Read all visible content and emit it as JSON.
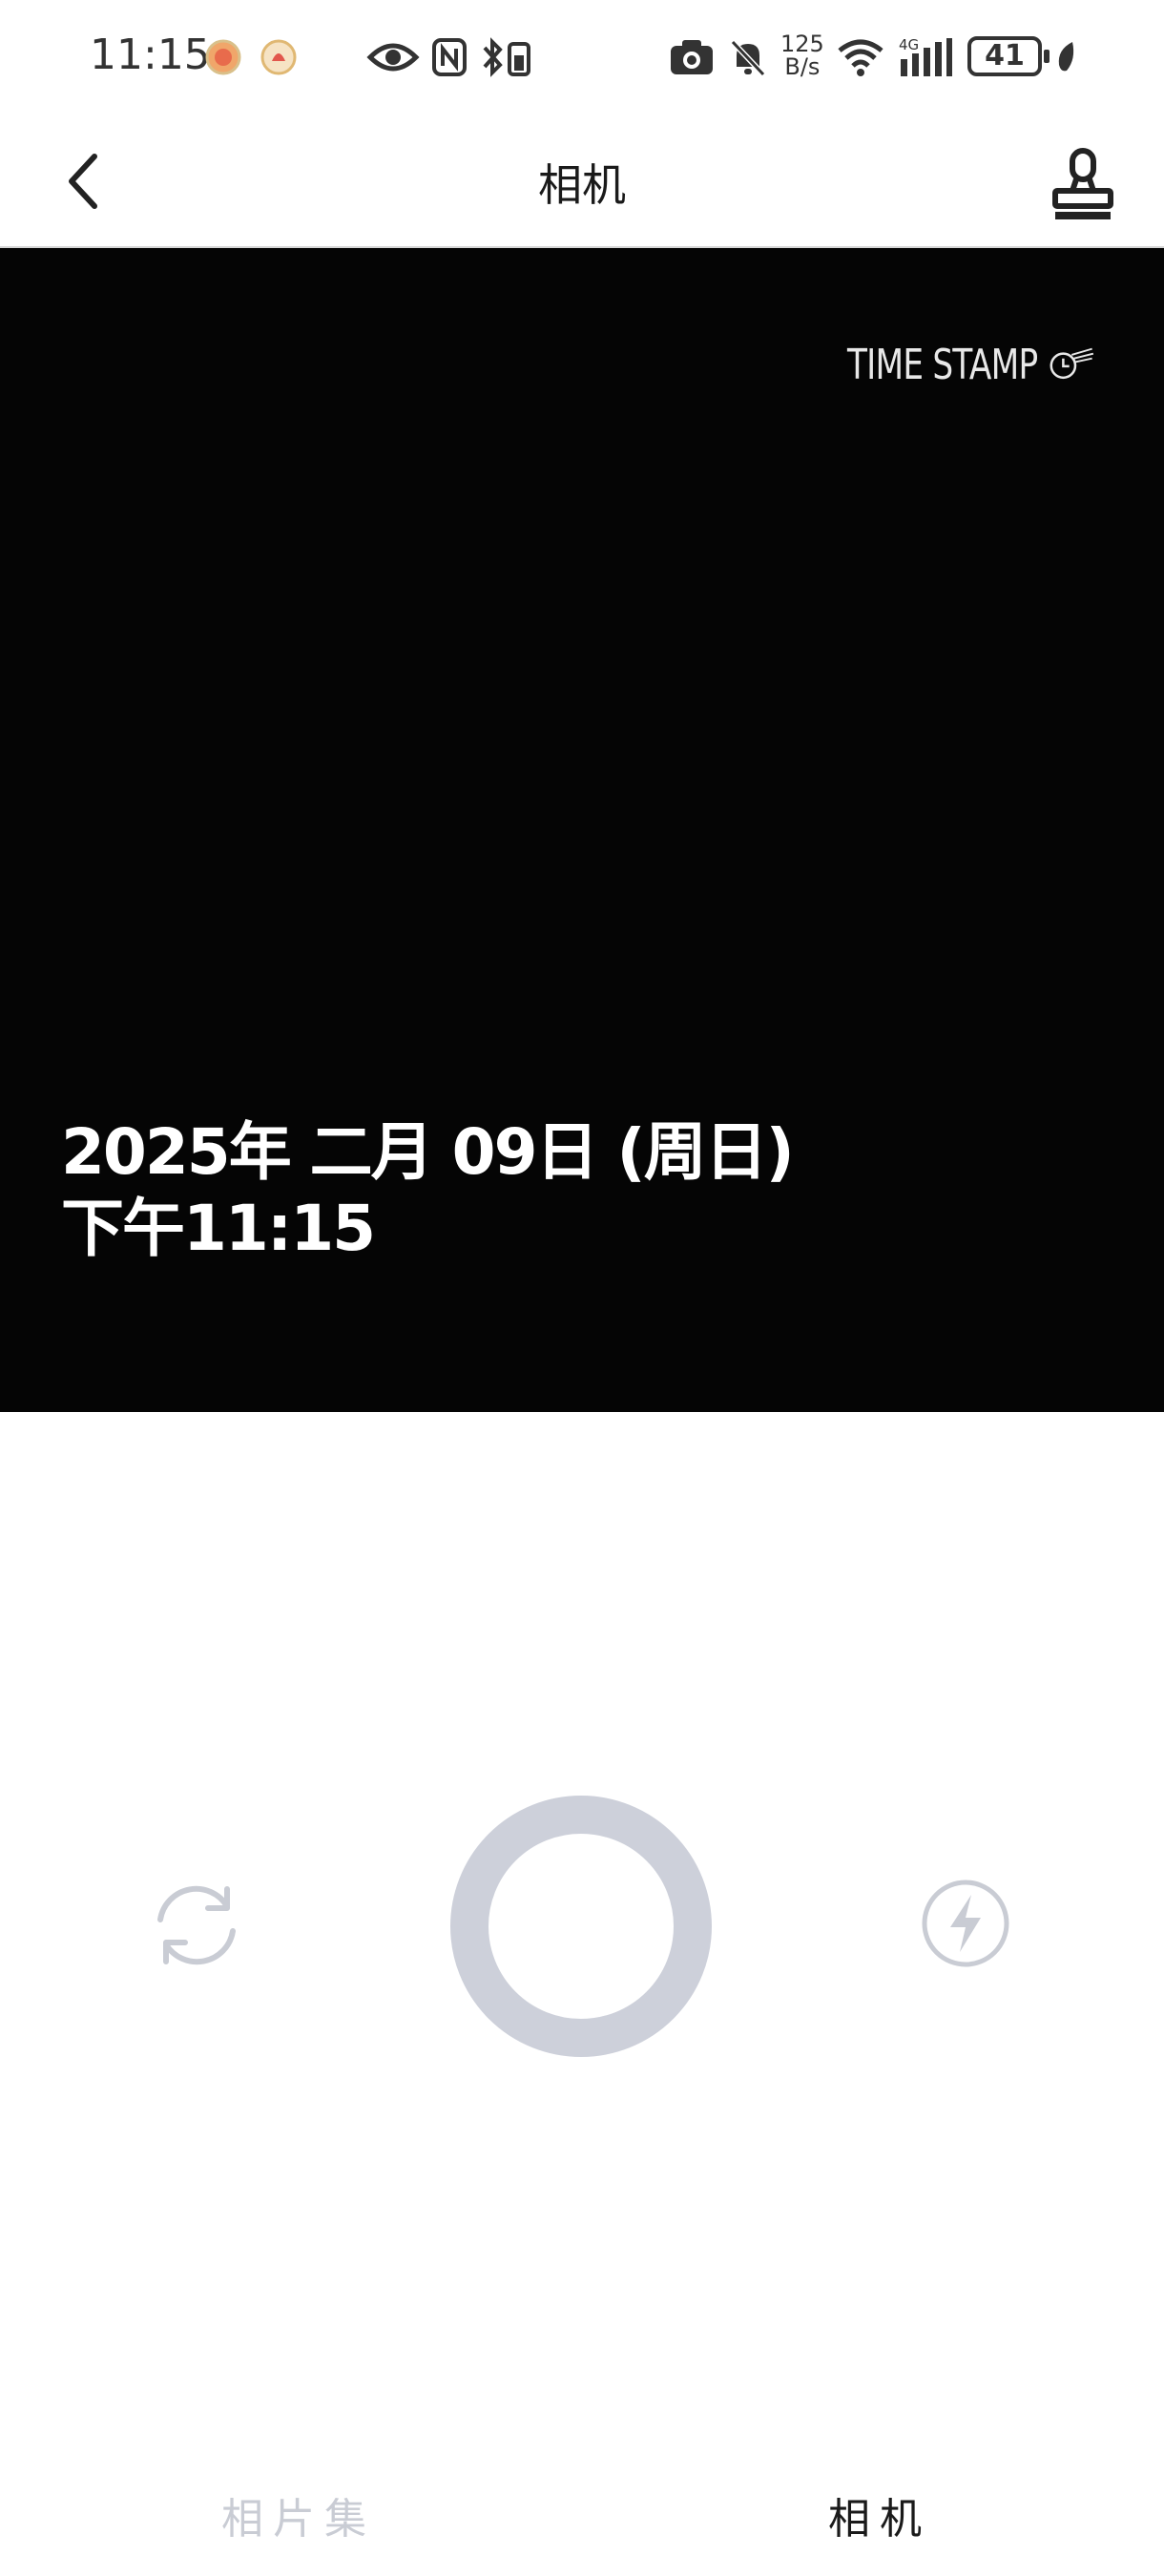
{
  "status_bar": {
    "time": "11:15",
    "net_speed_value": "125",
    "net_speed_unit": "B/s",
    "network": "4G",
    "battery": "41"
  },
  "header": {
    "title": "相机"
  },
  "preview": {
    "logo_text": "TIME STAMP",
    "date_line": "2025年 二月 09日 (周日)",
    "time_line": "下午11:15"
  },
  "tabs": {
    "album": "相片集",
    "camera": "相机"
  },
  "colors": {
    "preview_bg": "#050505",
    "shutter_ring": "#cdd0da",
    "icon_muted": "#c9ccd4",
    "active_tab": "#1a1a1a"
  }
}
